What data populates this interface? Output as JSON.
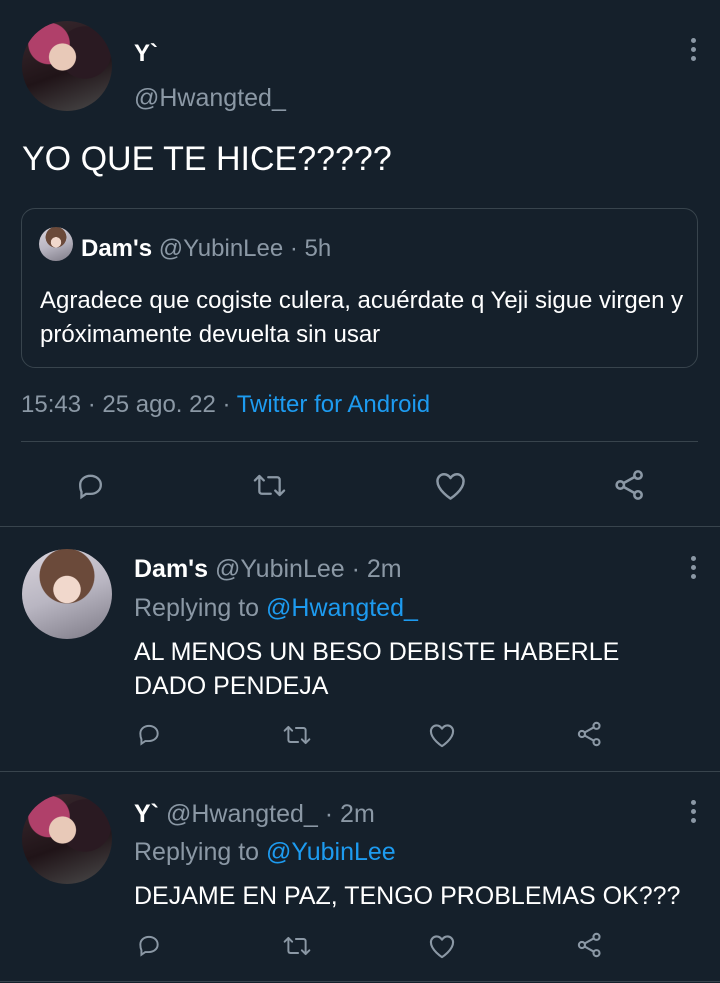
{
  "main_tweet": {
    "display_name": "Y`",
    "handle": "@Hwangted_",
    "text": "YO QUE TE HICE?????",
    "quoted": {
      "display_name": "Dam's",
      "handle": "@YubinLee",
      "time": "· 5h",
      "text": "Agradece que cogiste culera, acuérdate q Yeji sigue virgen y próximamente devuelta sin usar"
    },
    "timestamp": "15:43 · 25 ago. 22 ·",
    "source": "Twitter for Android"
  },
  "replies": [
    {
      "display_name": "Dam's",
      "handle": "@YubinLee",
      "time": "· 2m",
      "replying_label": "Replying to",
      "replying_to": "@Hwangted_",
      "text": "AL MENOS UN BESO DEBISTE HABERLE DADO PENDEJA"
    },
    {
      "display_name": "Y`",
      "handle": "@Hwangted_",
      "time": "· 2m",
      "replying_label": "Replying to",
      "replying_to": "@YubinLee",
      "text": "DEJAME EN PAZ, TENGO PROBLEMAS OK???"
    }
  ],
  "icons": [
    "more-options-icon",
    "reply-icon",
    "retweet-icon",
    "like-icon",
    "share-icon"
  ],
  "colors": {
    "background": "#15202b",
    "text": "#ffffff",
    "muted": "#8b98a5",
    "link": "#1d9bf0",
    "divider": "#38444d"
  }
}
